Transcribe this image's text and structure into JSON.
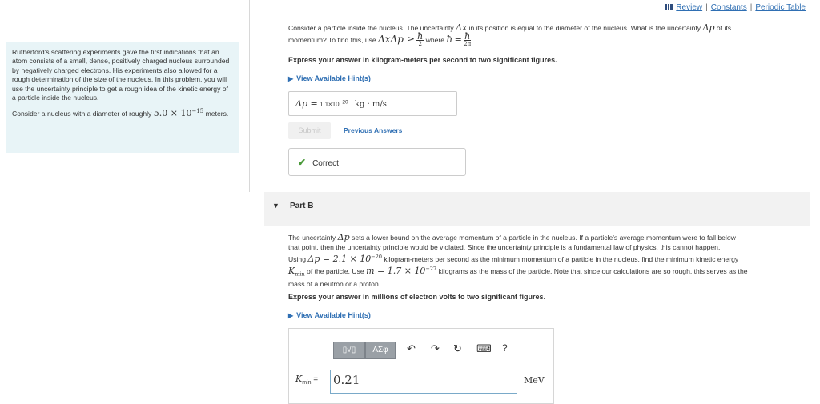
{
  "topnav": {
    "review": "Review",
    "constants": "Constants",
    "periodic_table": "Periodic Table",
    "sep": "|"
  },
  "intro": {
    "p1": "Rutherford's scattering experiments gave the first indications that an atom consists of a small, dense, positively charged nucleus surrounded by negatively charged electrons. His experiments also allowed for a rough determination of the size of the nucleus. In this problem, you will use the uncertainty principle to get a rough idea of the kinetic energy of a particle inside the nucleus.",
    "p2_start": "Consider a nucleus with a diameter of roughly",
    "p2_value": "5.0 × 10",
    "p2_exp": "−15",
    "p2_end": "meters."
  },
  "partA": {
    "q1": "Consider a particle inside the nucleus. The uncertainty",
    "q1_sym": "Δx",
    "q1_b": "in its position is equal to the diameter of the nucleus. What is the uncertainty",
    "q1_sym2": "Δp",
    "q1_c": "of its",
    "q2": "momentum? To find this, use",
    "q2_expr": "ΔxΔp ≥",
    "hbar": "ħ",
    "two": "2",
    "twopi": "2π",
    "q2_where": "where",
    "q2_eq": "=",
    "instruction": "Express your answer in kilogram-meters per second to two significant figures.",
    "hint": "View Available Hint(s)",
    "answer_label": "Δp =",
    "answer_mant": "1.1×10",
    "answer_exp": "−20",
    "answer_unit": "kg · m/s",
    "submit": "Submit",
    "previous": "Previous Answers",
    "correct": "Correct"
  },
  "partB": {
    "title": "Part B",
    "t1": "The uncertainty",
    "t1_sym": "Δp",
    "t1_b": "sets a lower bound on the average momentum of a particle in the nucleus. If a particle's average momentum were to fall below",
    "t2": "that point, then the uncertainty principle would be violated. Since the uncertainty principle is a fundamental law of physics, this cannot happen.",
    "t3": "Using",
    "t3_expr": "Δp = 2.1 × 10",
    "t3_exp": "−20",
    "t3_b": "kilogram-meters per second as the minimum momentum of a particle in the nucleus, find the minimum kinetic energy",
    "t4_sym": "K",
    "t4_sub": "min",
    "t4_a": "of the particle. Use",
    "t4_expr": "m = 1.7 × 10",
    "t4_exp": "−27",
    "t4_b": "kilograms as the mass of the particle. Note that since our calculations are so rough, this serves as the",
    "t5": "mass of a neutron or a proton.",
    "instruction": "Express your answer in millions of electron volts to two significant figures.",
    "hint": "View Available Hint(s)",
    "toolbar": {
      "templates": "▯√▯",
      "greek": "ΑΣφ",
      "undo": "↶",
      "redo": "↷",
      "reset": "↻",
      "keyboard": "⌨",
      "help": "?"
    },
    "input_label": "K",
    "input_sub": "min",
    "input_eq": "=",
    "input_value": "0.21",
    "unit": "MeV"
  }
}
